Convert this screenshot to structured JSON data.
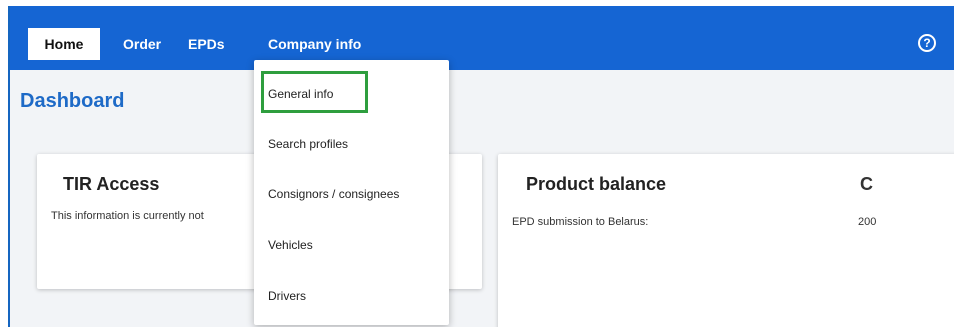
{
  "nav": {
    "home": "Home",
    "order": "Order",
    "epds": "EPDs",
    "company_info": "Company info",
    "help": "?"
  },
  "page": {
    "title": "Dashboard"
  },
  "tir_card": {
    "title": "TIR Access",
    "text": "This information is currently not"
  },
  "product_card": {
    "title": "Product balance",
    "refresh_glyph": "C",
    "rows": [
      {
        "label": "EPD submission to Belarus:",
        "value": "200"
      }
    ]
  },
  "dropdown": {
    "items": [
      "General info",
      "Search profiles",
      "Consignors / consignees",
      "Vehicles",
      "Drivers"
    ],
    "highlight_color": "#2e9e3e"
  },
  "colors": {
    "topbar": "#1565d3",
    "title": "#1e6ac7"
  }
}
